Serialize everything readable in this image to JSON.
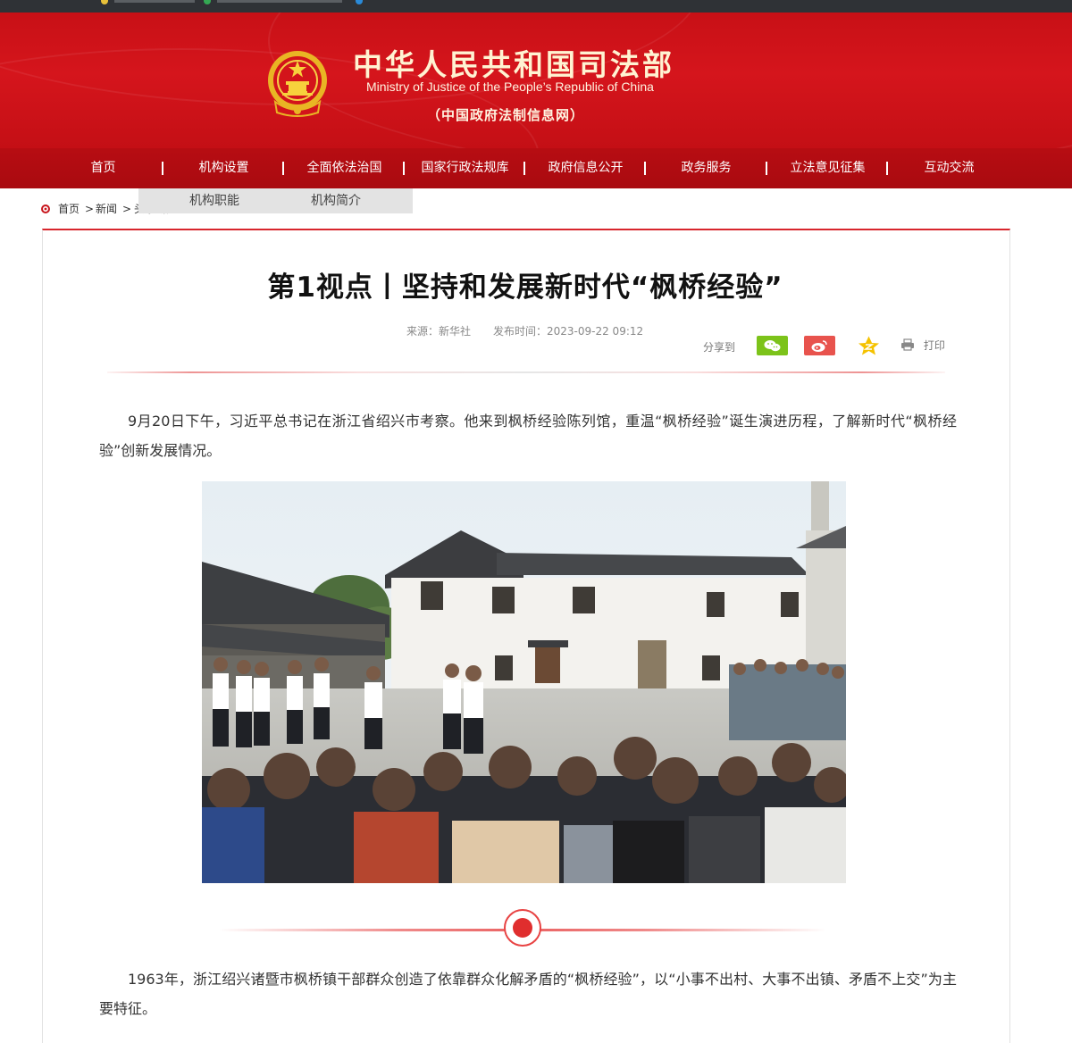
{
  "site": {
    "name_cn": "中华人民共和国司法部",
    "name_en": "Ministry of Justice of the People’s Republic of China",
    "subtitle": "（中国政府法制信息网）"
  },
  "nav": {
    "items": [
      "首页",
      "机构设置",
      "全面依法治国",
      "国家行政法规库",
      "政府信息公开",
      "政务服务",
      "立法意见征集",
      "互动交流"
    ]
  },
  "dropdown": {
    "items": [
      "机构职能",
      "机构简介"
    ]
  },
  "breadcrumb": {
    "items": [
      "首页",
      "新闻",
      "头条新闻"
    ],
    "separator": ">"
  },
  "article": {
    "title": "第1视点丨坚持和发展新时代“枫桥经验”",
    "source": "来源：新华社",
    "published": "发布时间：2023-09-22 09:12",
    "share_label": "分享到",
    "print_label": "打印",
    "paragraphs": [
      "9月20日下午，习近平总书记在浙江省绍兴市考察。他来到枫桥经验陈列馆，重温“枫桥经验”诞生演进历程，了解新时代“枫桥经验”创新发展情况。",
      "1963年，浙江绍兴诸暨市枫桥镇干部群众创造了依靠群众化解矛盾的“枫桥经验”，以“小事不出村、大事不出镇、矛盾不上交”为主要特征。"
    ]
  },
  "share_icons": [
    "wechat-icon",
    "weibo-icon",
    "qzone-icon",
    "printer-icon"
  ],
  "colors": {
    "brand_red": "#c81016",
    "nav_red": "#b70d12",
    "accent_red": "#e02e2e",
    "wechat_green": "#7cc31a",
    "weibo_red": "#e8534d",
    "qzone_yellow": "#f5c200"
  }
}
